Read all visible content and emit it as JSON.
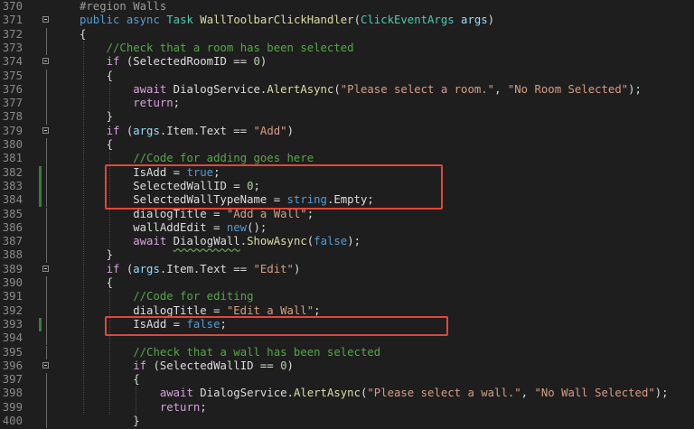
{
  "window": {
    "title": ""
  },
  "colors": {
    "background": "#1e1e1e",
    "keyword": "#569cd6",
    "control": "#d8a0df",
    "type": "#4ec9b0",
    "method": "#dcdcaa",
    "string": "#d69d85",
    "comment": "#57a64a",
    "highlight_box": "#e0473a"
  },
  "editor": {
    "lines": [
      {
        "n": "370",
        "t": [
          [
            "pre",
            "#region Walls"
          ]
        ]
      },
      {
        "n": "371",
        "t": [
          [
            "kw",
            "public"
          ],
          [
            "pl",
            " "
          ],
          [
            "kw",
            "async"
          ],
          [
            "pl",
            " "
          ],
          [
            "typ",
            "Task"
          ],
          [
            "pl",
            " "
          ],
          [
            "mth",
            "WallToolbarClickHandler"
          ],
          [
            "pl",
            "("
          ],
          [
            "typ",
            "ClickEventArgs"
          ],
          [
            "pl",
            " "
          ],
          [
            "prm",
            "args"
          ],
          [
            "pl",
            ")"
          ]
        ]
      },
      {
        "n": "372",
        "t": [
          [
            "pl",
            "{"
          ]
        ]
      },
      {
        "n": "373",
        "t": [
          [
            "pl",
            "    "
          ],
          [
            "cmt",
            "//Check that a room has been selected"
          ]
        ]
      },
      {
        "n": "374",
        "t": [
          [
            "pl",
            "    "
          ],
          [
            "ctl",
            "if"
          ],
          [
            "pl",
            " (SelectedRoomID == "
          ],
          [
            "num",
            "0"
          ],
          [
            "pl",
            ")"
          ]
        ]
      },
      {
        "n": "375",
        "t": [
          [
            "pl",
            "    {"
          ]
        ]
      },
      {
        "n": "376",
        "t": [
          [
            "pl",
            "        "
          ],
          [
            "ctl",
            "await"
          ],
          [
            "pl",
            " DialogService."
          ],
          [
            "mth",
            "AlertAsync"
          ],
          [
            "pl",
            "("
          ],
          [
            "str",
            "\"Please select a room.\""
          ],
          [
            "pl",
            ", "
          ],
          [
            "str",
            "\"No Room Selected\""
          ],
          [
            "pl",
            ");"
          ]
        ]
      },
      {
        "n": "377",
        "t": [
          [
            "pl",
            "        "
          ],
          [
            "ctl",
            "return"
          ],
          [
            "pl",
            ";"
          ]
        ]
      },
      {
        "n": "378",
        "t": [
          [
            "pl",
            "    }"
          ]
        ]
      },
      {
        "n": "379",
        "t": [
          [
            "pl",
            "    "
          ],
          [
            "ctl",
            "if"
          ],
          [
            "pl",
            " ("
          ],
          [
            "prm",
            "args"
          ],
          [
            "pl",
            ".Item.Text == "
          ],
          [
            "str",
            "\"Add\""
          ],
          [
            "pl",
            ")"
          ]
        ]
      },
      {
        "n": "380",
        "t": [
          [
            "pl",
            "    {"
          ]
        ]
      },
      {
        "n": "381",
        "t": [
          [
            "pl",
            "        "
          ],
          [
            "cmt",
            "//Code for adding goes here"
          ]
        ]
      },
      {
        "n": "382",
        "t": [
          [
            "pl",
            "        IsAdd = "
          ],
          [
            "kw",
            "true"
          ],
          [
            "pl",
            ";"
          ]
        ]
      },
      {
        "n": "383",
        "t": [
          [
            "pl",
            "        SelectedWallID = "
          ],
          [
            "num",
            "0"
          ],
          [
            "pl",
            ";"
          ]
        ]
      },
      {
        "n": "384",
        "t": [
          [
            "pl",
            "        SelectedWallTypeName = "
          ],
          [
            "kw",
            "string"
          ],
          [
            "pl",
            "."
          ],
          [
            "pl",
            "Empty;"
          ]
        ]
      },
      {
        "n": "385",
        "t": [
          [
            "pl",
            "        dialogTitle = "
          ],
          [
            "str",
            "\"Add a Wall\""
          ],
          [
            "pl",
            ";"
          ]
        ]
      },
      {
        "n": "386",
        "t": [
          [
            "pl",
            "        wallAddEdit = "
          ],
          [
            "kw",
            "new"
          ],
          [
            "pl",
            "();"
          ]
        ]
      },
      {
        "n": "387",
        "t": [
          [
            "pl",
            "        "
          ],
          [
            "ctl",
            "await"
          ],
          [
            "pl",
            " "
          ],
          [
            "sq",
            "DialogWall"
          ],
          [
            "pl",
            "."
          ],
          [
            "mth",
            "ShowAsync"
          ],
          [
            "pl",
            "("
          ],
          [
            "kw",
            "false"
          ],
          [
            "pl",
            ");"
          ]
        ]
      },
      {
        "n": "388",
        "t": [
          [
            "pl",
            "    }"
          ]
        ]
      },
      {
        "n": "389",
        "t": [
          [
            "pl",
            "    "
          ],
          [
            "ctl",
            "if"
          ],
          [
            "pl",
            " ("
          ],
          [
            "prm",
            "args"
          ],
          [
            "pl",
            ".Item.Text == "
          ],
          [
            "str",
            "\"Edit\""
          ],
          [
            "pl",
            ")"
          ]
        ]
      },
      {
        "n": "390",
        "t": [
          [
            "pl",
            "    {"
          ]
        ]
      },
      {
        "n": "391",
        "t": [
          [
            "pl",
            "        "
          ],
          [
            "cmt",
            "//Code for editing"
          ]
        ]
      },
      {
        "n": "392",
        "t": [
          [
            "pl",
            "        dialogTitle = "
          ],
          [
            "str",
            "\"Edit a Wall\""
          ],
          [
            "pl",
            ";"
          ]
        ]
      },
      {
        "n": "393",
        "t": [
          [
            "pl",
            "        IsAdd = "
          ],
          [
            "kw",
            "false"
          ],
          [
            "pl",
            ";"
          ]
        ]
      },
      {
        "n": "394",
        "t": []
      },
      {
        "n": "395",
        "t": [
          [
            "pl",
            "        "
          ],
          [
            "cmt",
            "//Check that a wall has been selected"
          ]
        ]
      },
      {
        "n": "396",
        "t": [
          [
            "pl",
            "        "
          ],
          [
            "ctl",
            "if"
          ],
          [
            "pl",
            " (SelectedWallID == "
          ],
          [
            "num",
            "0"
          ],
          [
            "pl",
            ")"
          ]
        ]
      },
      {
        "n": "397",
        "t": [
          [
            "pl",
            "        {"
          ]
        ]
      },
      {
        "n": "398",
        "t": [
          [
            "pl",
            "            "
          ],
          [
            "ctl",
            "await"
          ],
          [
            "pl",
            " DialogService."
          ],
          [
            "mth",
            "AlertAsync"
          ],
          [
            "pl",
            "("
          ],
          [
            "str",
            "\"Please select a wall.\""
          ],
          [
            "pl",
            ", "
          ],
          [
            "str",
            "\"No Wall Selected\""
          ],
          [
            "pl",
            ");"
          ]
        ]
      },
      {
        "n": "399",
        "t": [
          [
            "pl",
            "            "
          ],
          [
            "ctl",
            "return"
          ],
          [
            "pl",
            ";"
          ]
        ]
      },
      {
        "n": "400",
        "t": [
          [
            "pl",
            "        }"
          ]
        ]
      }
    ]
  }
}
